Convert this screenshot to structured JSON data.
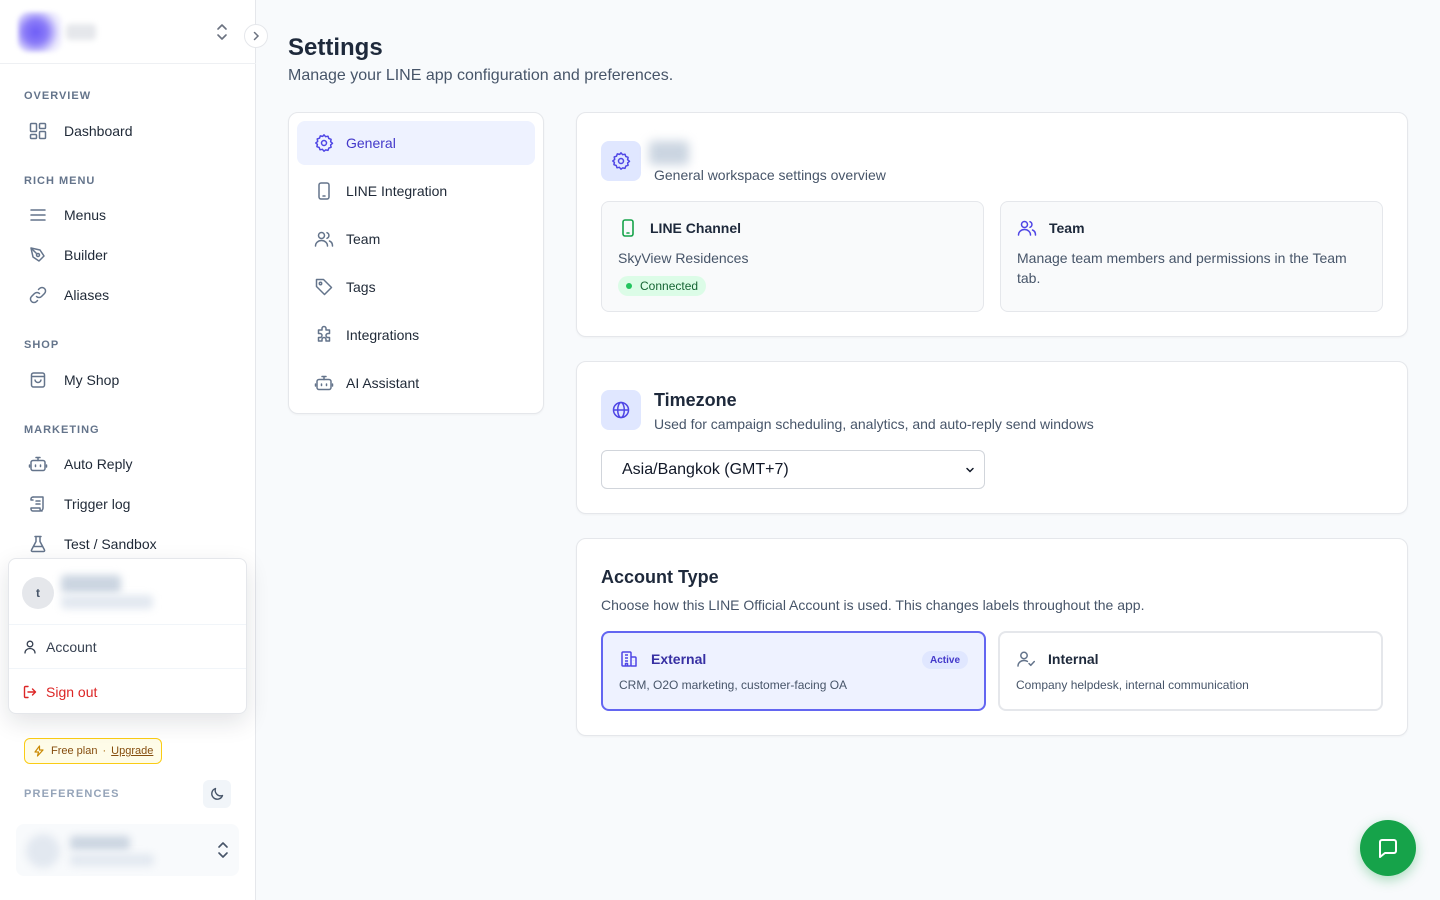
{
  "sidebar": {
    "sections": {
      "overview": "OVERVIEW",
      "rich_menu": "RICH MENU",
      "shop": "SHOP",
      "marketing": "MARKETING"
    },
    "items": {
      "dashboard": "Dashboard",
      "menus": "Menus",
      "builder": "Builder",
      "aliases": "Aliases",
      "my_shop": "My Shop",
      "auto_reply": "Auto Reply",
      "trigger_log": "Trigger log",
      "test_sandbox": "Test / Sandbox"
    },
    "popup": {
      "avatar_initial": "t",
      "account": "Account",
      "sign_out": "Sign out"
    },
    "plan": {
      "label": "Free plan",
      "separator": "·",
      "upgrade": "Upgrade"
    },
    "preferences_label": "PREFERENCES"
  },
  "page": {
    "title": "Settings",
    "subtitle": "Manage your LINE app configuration and preferences."
  },
  "settings_nav": {
    "general": "General",
    "line_integration": "LINE Integration",
    "team": "Team",
    "tags": "Tags",
    "integrations": "Integrations",
    "ai_assistant": "AI Assistant"
  },
  "general_card": {
    "description": "General workspace settings overview",
    "line_channel": {
      "title": "LINE Channel",
      "name": "SkyView Residences",
      "status": "Connected"
    },
    "team": {
      "title": "Team",
      "body": "Manage team members and permissions in the Team tab."
    }
  },
  "timezone_card": {
    "title": "Timezone",
    "description": "Used for campaign scheduling, analytics, and auto-reply send windows",
    "selected": "Asia/Bangkok (GMT+7)"
  },
  "account_type_card": {
    "title": "Account Type",
    "description": "Choose how this LINE Official Account is used. This changes labels throughout the app.",
    "external": {
      "title": "External",
      "badge": "Active",
      "desc": "CRM, O2O marketing, customer-facing OA"
    },
    "internal": {
      "title": "Internal",
      "desc": "Company helpdesk, internal communication"
    }
  },
  "colors": {
    "accent": "#4f46e5",
    "accent_bg": "#eef2ff",
    "success": "#16a34a",
    "danger": "#dc2626"
  }
}
